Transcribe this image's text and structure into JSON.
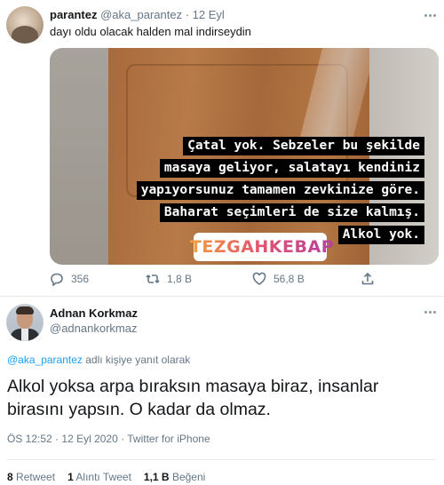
{
  "tweet1": {
    "display_name": "parantez",
    "handle": "@aka_parantez",
    "separator": "·",
    "date": "12 Eyl",
    "text": "dayı oldu olacak halden mal indirseydin",
    "media": {
      "overlay_lines": [
        "Çatal yok. Sebzeler bu şekilde",
        "masaya geliyor, salatayı kendiniz",
        "yapıyorsunuz tamamen zevkinize göre.",
        "Baharat seçimleri de size kalmış.",
        "Alkol yok."
      ],
      "location_sticker": "TEZGAHKEBAP"
    },
    "actions": {
      "reply_count": "356",
      "retweet_count": "1,8 B",
      "like_count": "56,8 B"
    }
  },
  "tweet2": {
    "display_name": "Adnan Korkmaz",
    "handle": "@adnankorkmaz",
    "reply_to_handle": "@aka_parantez",
    "reply_to_suffix": "adlı kişiye yanıt olarak",
    "text": "Alkol yoksa arpa bıraksın masaya biraz, insanlar birasını yapsın. O kadar da olmaz.",
    "time": "ÖS 12:52",
    "date": "12 Eyl 2020",
    "client": "Twitter for iPhone",
    "separator": "·",
    "stats": [
      {
        "count": "8",
        "label": "Retweet"
      },
      {
        "count": "1",
        "label": "Alıntı Tweet"
      },
      {
        "count": "1,1 B",
        "label": "Beğeni"
      }
    ]
  },
  "colors": {
    "muted": "#657786",
    "link": "#1da1f2",
    "divider": "#e6ecf0"
  },
  "icons": [
    "reply-icon",
    "retweet-icon",
    "heart-icon",
    "share-icon",
    "more-options-icon",
    "location-pin-icon"
  ]
}
